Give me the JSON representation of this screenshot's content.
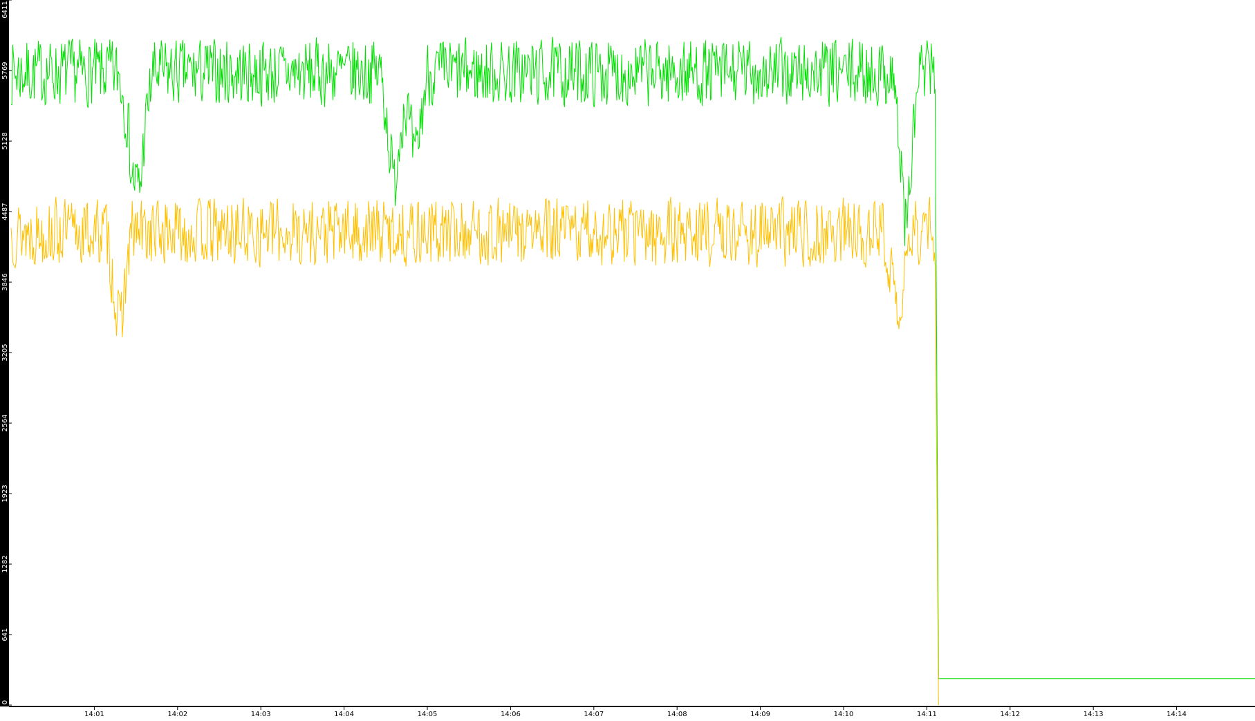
{
  "chart_data": {
    "type": "line",
    "title": "",
    "xlabel": "",
    "ylabel": "",
    "y_ticks": [
      0,
      641,
      1282,
      1923,
      2564,
      3205,
      3846,
      4487,
      5128,
      5769,
      6411
    ],
    "ylim": [
      0,
      6411
    ],
    "x_ticks": [
      "14:01",
      "14:02",
      "14:03",
      "14:04",
      "14:05",
      "14:06",
      "14:07",
      "14:08",
      "14:09",
      "14:10",
      "14:11",
      "14:12",
      "14:13",
      "14:14"
    ],
    "x_range_minutes": [
      0,
      15
    ],
    "grid": false,
    "legend": "none",
    "background": "#ffffff",
    "axis_band_color": "#000000",
    "axis_text_color": "#ffffff",
    "series": [
      {
        "color": "#00e000",
        "segments": [
          {
            "x_start": 0.0,
            "x_end": 11.1,
            "mean": 5750,
            "noise": 330,
            "seed": 7,
            "dips": [
              [
                1.45,
                5100
              ],
              [
                4.6,
                4700
              ],
              [
                4.85,
                4900
              ],
              [
                1.55,
                4900
              ],
              [
                10.75,
                4300
              ]
            ]
          },
          {
            "x_start": 11.1,
            "x_end": 11.14,
            "from": 5600,
            "to": 300
          },
          {
            "x_start": 11.14,
            "x_end": 15.0,
            "mean": 240,
            "noise": 0,
            "seed": 0
          }
        ]
      },
      {
        "color": "#ffc000",
        "segments": [
          {
            "x_start": 0.0,
            "x_end": 11.1,
            "mean": 4300,
            "noise": 330,
            "seed": 13,
            "dips": [
              [
                1.3,
                3400
              ],
              [
                10.65,
                3400
              ]
            ]
          },
          {
            "x_start": 11.1,
            "x_end": 11.14,
            "from": 4000,
            "to": 0
          }
        ]
      }
    ]
  }
}
